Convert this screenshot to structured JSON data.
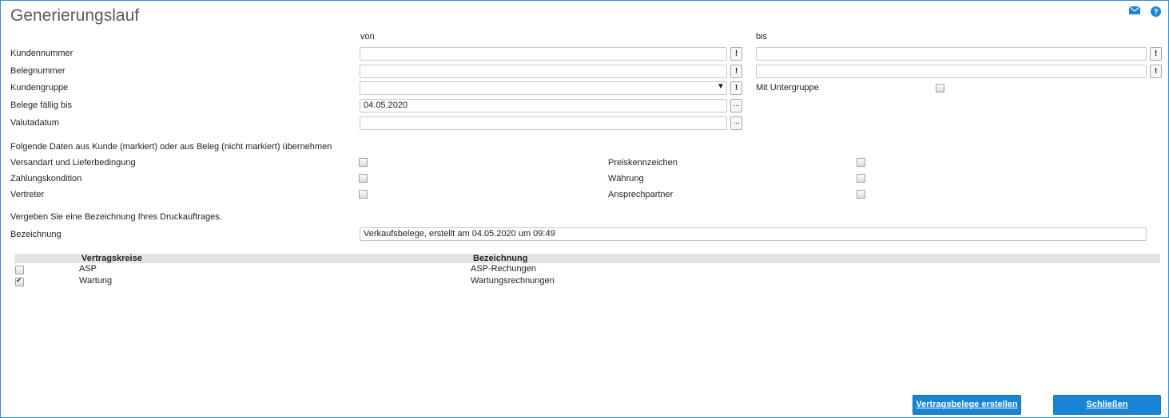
{
  "title": "Generierungslauf",
  "columns": {
    "von": "von",
    "bis": "bis"
  },
  "fields": {
    "kundennummer": {
      "label": "Kundennummer",
      "von": "",
      "bis": ""
    },
    "belegnummer": {
      "label": "Belegnummer",
      "von": "",
      "bis": ""
    },
    "kundengruppe": {
      "label": "Kundengruppe",
      "value": "",
      "untergruppe_label": "Mit Untergruppe",
      "untergruppe_checked": false
    },
    "belege_faellig": {
      "label": "Belege fällig bis",
      "value": "04.05.2020"
    },
    "valutadatum": {
      "label": "Valutadatum",
      "value": ""
    }
  },
  "button_glyphs": {
    "lookup": "!",
    "dropdown": "▼",
    "picker": "..."
  },
  "uebernahme": {
    "heading": "Folgende Daten aus Kunde (markiert) oder aus Beleg (nicht markiert) übernehmen",
    "left": [
      {
        "label": "Versandart und Lieferbedingung",
        "checked": false
      },
      {
        "label": "Zahlungskondition",
        "checked": false
      },
      {
        "label": "Vertreter",
        "checked": false
      }
    ],
    "right": [
      {
        "label": "Preiskennzeichen",
        "checked": false
      },
      {
        "label": "Währung",
        "checked": false
      },
      {
        "label": "Ansprechpartner",
        "checked": false
      }
    ]
  },
  "druckauftrag": {
    "heading": "Vergeben Sie eine Bezeichnung Ihres Druckauftrages.",
    "label": "Bezeichnung",
    "value": "Verkaufsbelege, erstellt am 04.05.2020 um 09:49"
  },
  "table": {
    "headers": [
      "Vertragskreise",
      "Bezeichnung"
    ],
    "rows": [
      {
        "checked": false,
        "kreis": "ASP",
        "bezeichnung": "ASP-Rechungen"
      },
      {
        "checked": true,
        "kreis": "Wartung",
        "bezeichnung": "Wartungsrechnungen"
      }
    ]
  },
  "buttons": {
    "create": "Vertragsbelege erstellen",
    "close": "Schließen"
  },
  "icons": {
    "mail": "mail-icon",
    "help": "help-icon"
  },
  "colors": {
    "accent": "#1a84d4",
    "border": "#2f8fd6"
  }
}
